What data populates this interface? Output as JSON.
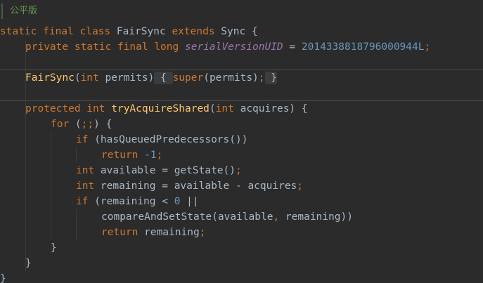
{
  "doc_comment": "公平版",
  "code": {
    "l1": {
      "kw": "static final class",
      "name": "FairSync",
      "extends": "extends",
      "parent": "Sync",
      "brace": " {"
    },
    "l2": {
      "kw": "private static final long",
      "field": "serialVersionUID",
      "eq": " = ",
      "value": "2014338818796000944L",
      "semi": ";"
    },
    "l3": {
      "ctor": "FairSync",
      "open": "(",
      "type": "int",
      "param": " permits)",
      "fold_open": " { ",
      "super": "super",
      "args": "(permits)",
      "semi": ";",
      "fold_close": " }"
    },
    "l4": {
      "kw": "protected int",
      "method": "tryAcquireShared",
      "open": "(",
      "type": "int",
      "param": " acquires) {"
    },
    "l5": {
      "kw": "for",
      "rest_a": " (",
      "semi1": ";;",
      "rest_b": ") {"
    },
    "l6": {
      "kw": "if",
      "rest": " (hasQueuedPredecessors())"
    },
    "l7": {
      "kw": "return",
      "num": " -1",
      "semi": ";"
    },
    "l8": {
      "type": "int",
      "rest": " available = getState()",
      "semi": ";"
    },
    "l9": {
      "type": "int",
      "rest": " remaining = available - acquires",
      "semi": ";"
    },
    "l10": {
      "kw": "if",
      "rest_a": " (remaining < ",
      "num": "0",
      "rest_b": " ||"
    },
    "l11": {
      "call": "compareAndSetState(available",
      "comma": ",",
      "rest": " remaining))"
    },
    "l12": {
      "kw": "return",
      "rest": " remaining",
      "semi": ";"
    },
    "l13": {
      "brace": "}"
    },
    "l14": {
      "brace": "}"
    },
    "l15": {
      "brace": "}"
    }
  },
  "colors": {
    "background": "#2b2b2b",
    "keyword": "#cc7832",
    "function": "#ffc66d",
    "number": "#6897bb",
    "field": "#9876aa",
    "text": "#a9b7c6",
    "doc": "#629755"
  }
}
